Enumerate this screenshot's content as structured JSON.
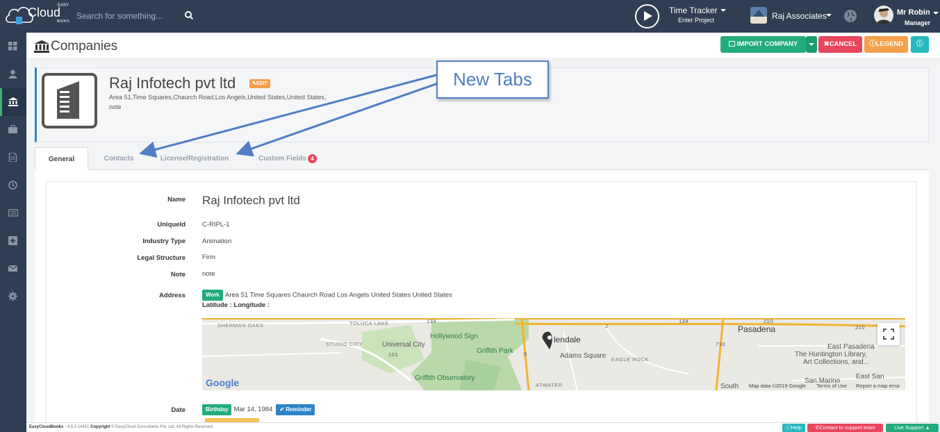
{
  "topbar": {
    "logo_text": "Cloud",
    "logo_easy": "EASY",
    "logo_books": "BOOKS",
    "search_placeholder": "Search for something...",
    "time_tracker": "Time Tracker",
    "enter_project": "Enter Project",
    "org_name": "Raj Associates",
    "user_name": "Mr Robin",
    "user_role": "Manager"
  },
  "sidebar": {
    "items": [
      "dashboard-icon",
      "user-icon",
      "bank-icon",
      "briefcase-icon",
      "document-icon",
      "clock-icon",
      "id-card-icon",
      "plus-square-icon",
      "envelope-icon",
      "gear-icon"
    ],
    "active_index": 2
  },
  "page": {
    "title": "Companies",
    "buttons": {
      "import": "IMPORT COMPANY",
      "cancel": "CANCEL",
      "legend": "LEGEND"
    }
  },
  "company": {
    "name": "Raj Infotech pvt ltd",
    "edit_label": "EDIT",
    "address": "Area 51,Time Squares,Chaurch Road,Los Angels,United States,United States,",
    "note": "note"
  },
  "tabs": [
    {
      "label": "General",
      "active": true
    },
    {
      "label": "Contacts",
      "active": false
    },
    {
      "label": "License/Registration",
      "active": false
    },
    {
      "label": "Custom Fields",
      "active": false,
      "badge": "4"
    }
  ],
  "details": {
    "name_label": "Name",
    "name_value": "Raj Infotech pvt ltd",
    "uid_label": "UniqueId",
    "uid_value": "C-RIPL-1",
    "industry_label": "Industry Type",
    "industry_value": "Animation",
    "legal_label": "Legal Structure",
    "legal_value": "Firm",
    "note_label": "Note",
    "note_value": "note",
    "address_label": "Address",
    "address_badge": "Work",
    "address_value": "Area 51 Time Squares Chaurch Road Los Angels United States United States",
    "latlng_label": "Latitude : Longitude :",
    "date_label": "Date",
    "date_badge": "Birthday",
    "date_value": "Mar 14, 1984",
    "reminder_label": "Reminder"
  },
  "map": {
    "labels": {
      "sherman_oaks": "SHERMAN OAKS",
      "toluca_lake": "TOLUCA LAKE",
      "studio_city": "STUDIO CITY",
      "universal_city": "Universal City",
      "hollywood_sign": "Hollywood Sign",
      "griffith_park": "Griffith Park",
      "griffith_observatory": "Griffith Observatory",
      "glendale": "lendale",
      "adams_square": "Adams Square",
      "eagle_rock": "EAGLE ROCK",
      "pasadena": "Pasadena",
      "east_pasadena": "East Pasadena",
      "huntington": "The Huntington Library,",
      "huntington2": "Art Collections, and...",
      "san_marino": "San Marino",
      "east_san": "East San",
      "south": "South",
      "atwater": "ATWATER",
      "r134a": "134",
      "r134b": "134",
      "r2": "2",
      "r210a": "210",
      "r210b": "210",
      "r101": "101",
      "r5": "5",
      "r710": "710"
    },
    "google": "Google",
    "map_data": "Map data ©2019 Google",
    "terms": "Terms of Use",
    "report": "Report a map error"
  },
  "footer": {
    "brand": "EasyCloudBooks",
    "version": " - 4.8.0.14451 ",
    "copyright_label": "Copyright",
    "copyright": " © EasyCloud Consultants Pvt. Ltd. All Rights Reserved",
    "help": "Help",
    "contact": "Contact to support team",
    "live": "Live Support"
  },
  "annotation": {
    "text": "New Tabs"
  },
  "colors": {
    "topbar": "#2f3e53",
    "green": "#22ac7c",
    "red": "#e8465d",
    "orange": "#f5a04b",
    "teal": "#26b8bd",
    "blue": "#2d84c8"
  }
}
